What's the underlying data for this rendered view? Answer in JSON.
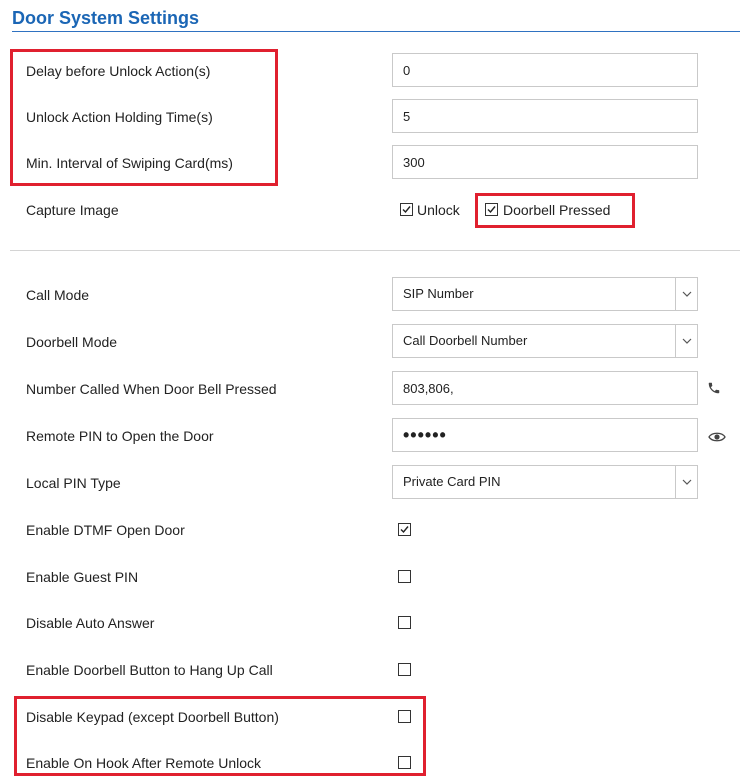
{
  "page": {
    "title": "Door System Settings"
  },
  "fields": {
    "delay_before_unlock": {
      "label": "Delay before Unlock Action(s)",
      "value": "0"
    },
    "unlock_holding_time": {
      "label": "Unlock Action Holding Time(s)",
      "value": "5"
    },
    "min_interval_swiping": {
      "label": "Min. Interval of Swiping Card(ms)",
      "value": "300"
    },
    "capture_image": {
      "label": "Capture Image",
      "unlock_label": "Unlock",
      "unlock_checked": true,
      "doorbell_label": "Doorbell Pressed",
      "doorbell_checked": true
    },
    "call_mode": {
      "label": "Call Mode",
      "value": "SIP Number"
    },
    "doorbell_mode": {
      "label": "Doorbell Mode",
      "value": "Call Doorbell Number"
    },
    "number_called": {
      "label": "Number Called When Door Bell Pressed",
      "value": "803,806,"
    },
    "remote_pin": {
      "label": "Remote PIN to Open the Door",
      "value": "••••••"
    },
    "local_pin_type": {
      "label": "Local PIN Type",
      "value": "Private Card PIN"
    },
    "enable_dtmf": {
      "label": "Enable DTMF Open Door",
      "checked": true
    },
    "enable_guest_pin": {
      "label": "Enable Guest PIN",
      "checked": false
    },
    "disable_auto_answer": {
      "label": "Disable Auto Answer",
      "checked": false
    },
    "enable_doorbell_hangup": {
      "label": "Enable Doorbell Button to Hang Up Call",
      "checked": false
    },
    "disable_keypad": {
      "label": "Disable Keypad (except Doorbell Button)",
      "checked": false
    },
    "enable_on_hook": {
      "label": "Enable On Hook After Remote Unlock",
      "checked": false
    }
  },
  "icons": {
    "phone": "phone-icon",
    "eye": "eye-icon",
    "dropdown": "chevron-down-icon"
  },
  "colors": {
    "title": "#1b66b5",
    "highlight": "#e0202f",
    "icon": "#444444"
  }
}
